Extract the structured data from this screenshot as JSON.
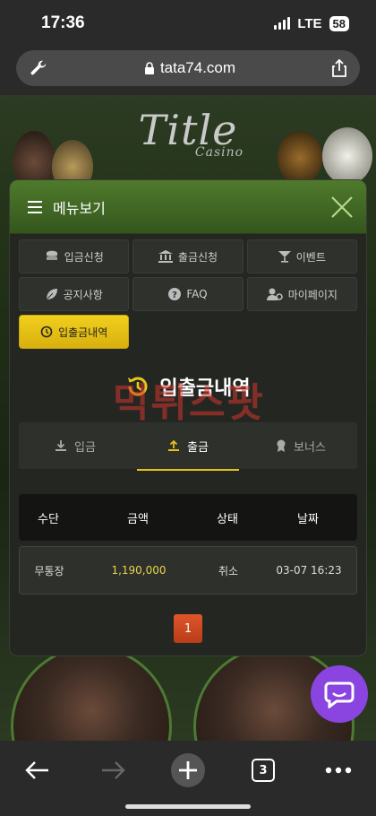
{
  "status_bar": {
    "time": "17:36",
    "network": "LTE",
    "battery": "58"
  },
  "browser": {
    "url": "tata74.com"
  },
  "site": {
    "logo_text": "Title",
    "logo_sub": "Casino"
  },
  "menu": {
    "title": "메뉴보기",
    "items": [
      {
        "label": "입금신청",
        "icon": "coins-icon"
      },
      {
        "label": "출금신청",
        "icon": "bank-icon"
      },
      {
        "label": "이벤트",
        "icon": "cocktail-icon"
      },
      {
        "label": "공지사항",
        "icon": "leaf-icon"
      },
      {
        "label": "FAQ",
        "icon": "question-icon"
      },
      {
        "label": "마이페이지",
        "icon": "user-gear-icon"
      },
      {
        "label": "입출금내역",
        "icon": "history-icon",
        "active": true
      }
    ]
  },
  "section": {
    "title": "입출금내역"
  },
  "watermark": "먹튀스팟",
  "tabs": [
    {
      "label": "입금",
      "icon": "download-icon"
    },
    {
      "label": "출금",
      "icon": "upload-icon",
      "active": true
    },
    {
      "label": "보너스",
      "icon": "medal-icon"
    }
  ],
  "table": {
    "headers": [
      "수단",
      "금액",
      "상태",
      "날짜"
    ],
    "rows": [
      {
        "method": "무통장",
        "amount": "1,190,000",
        "status": "취소",
        "date": "03-07 16:23"
      }
    ]
  },
  "pagination": {
    "current": "1"
  },
  "toolbar": {
    "tab_count": "3"
  },
  "colors": {
    "accent_yellow": "#e4c21a",
    "header_green": "#4f7a2c",
    "page_red": "#c84620",
    "chat_purple": "#8a44e0"
  }
}
